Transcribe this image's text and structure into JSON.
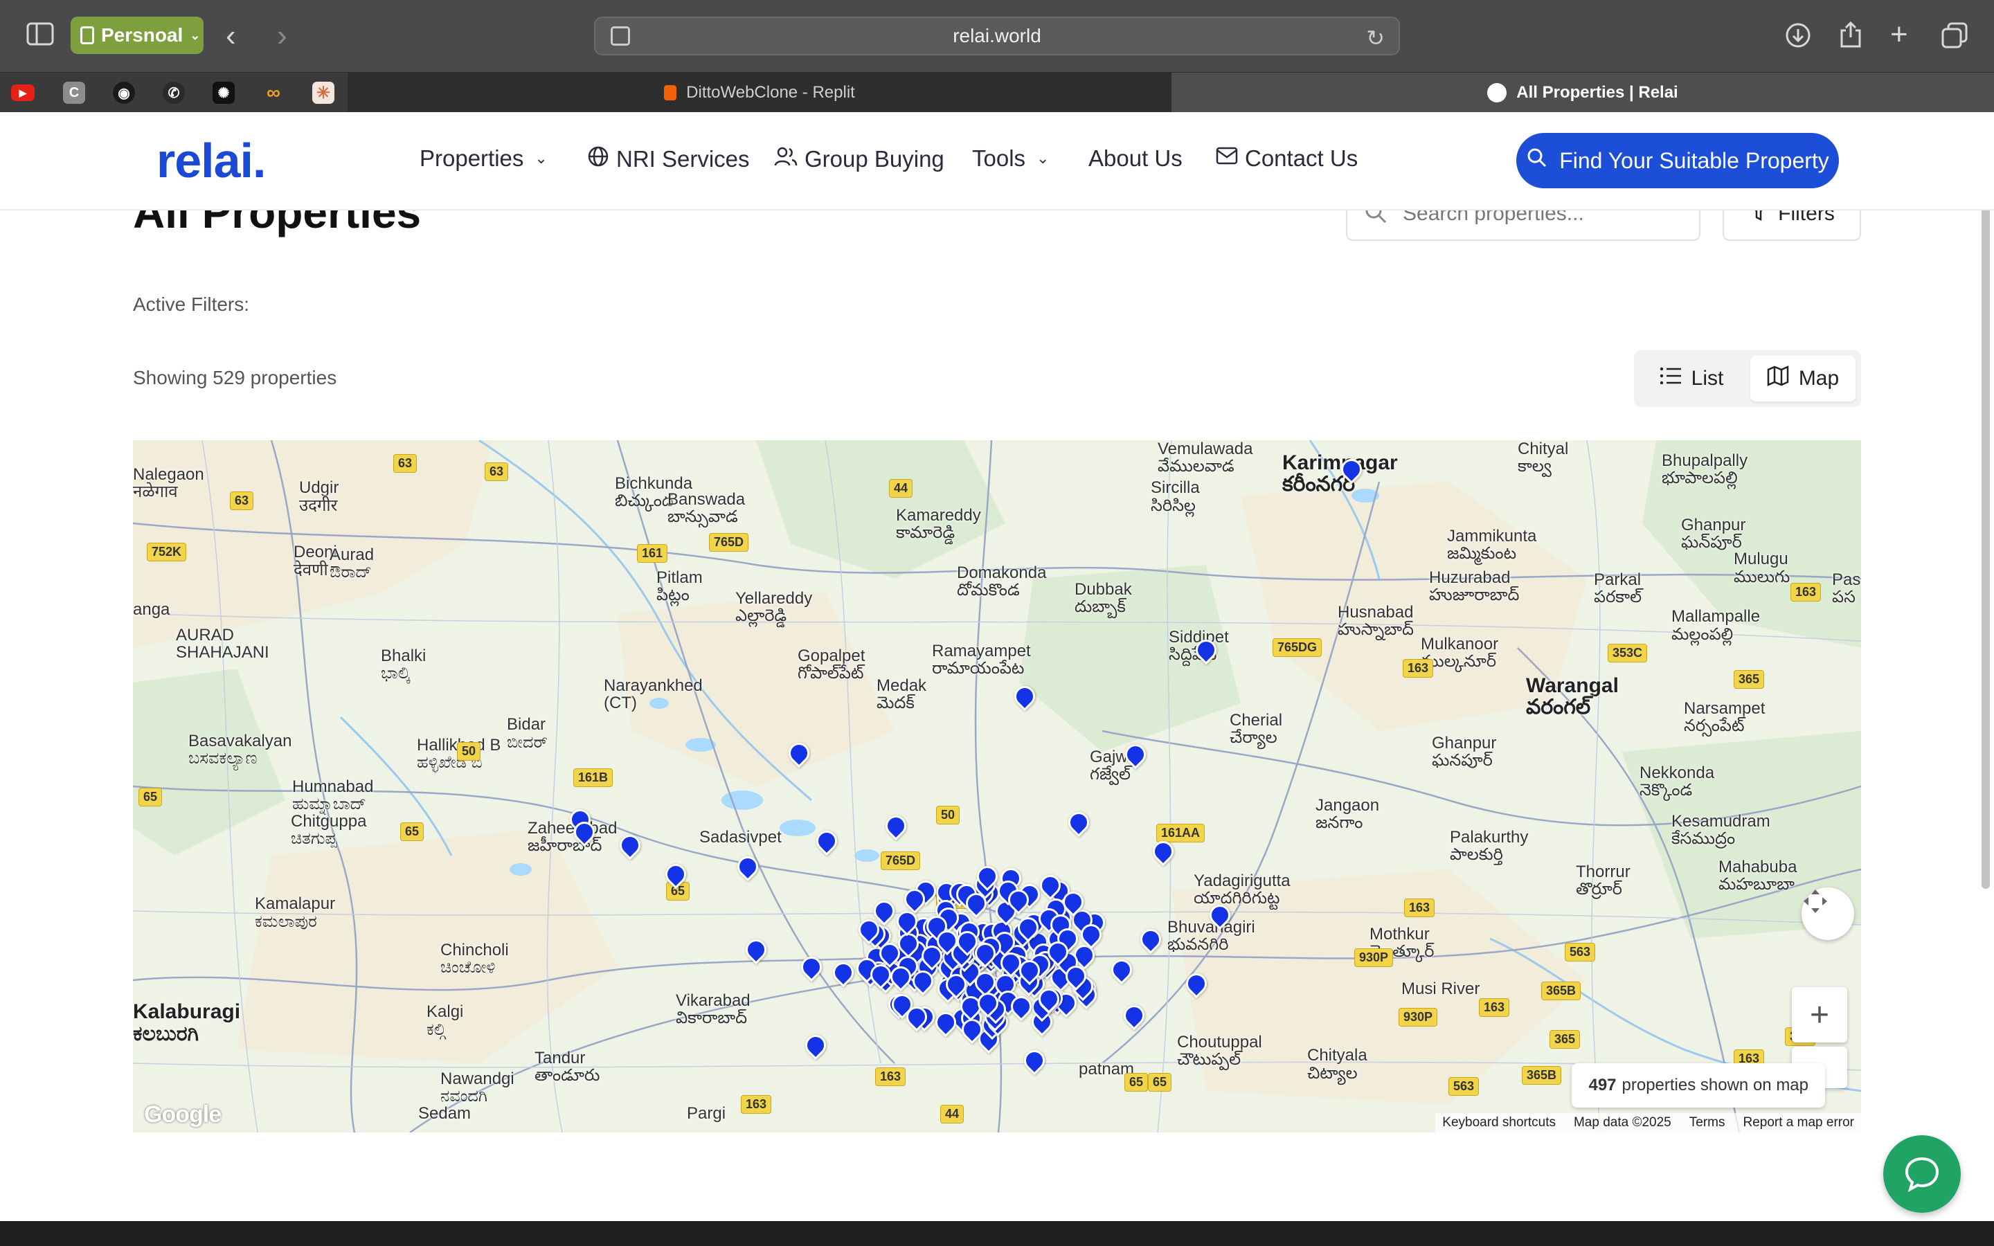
{
  "browser": {
    "profile_label": "Persnoal",
    "url": "relai.world",
    "tabs": [
      {
        "title": "DittoWebClone - Replit"
      },
      {
        "title": "All Properties | Relai"
      }
    ],
    "pinned": [
      "youtube",
      "c",
      "github",
      "whatsapp",
      "chatgpt",
      "infinity",
      "claude"
    ]
  },
  "site": {
    "logo": "relai.",
    "nav": {
      "properties": "Properties",
      "nri": "NRI Services",
      "group": "Group Buying",
      "tools": "Tools",
      "about": "About Us",
      "contact": "Contact Us"
    },
    "cta": "Find Your Suitable Property"
  },
  "page": {
    "title": "All Properties",
    "search_placeholder": "Search properties...",
    "filters_label": "Filters",
    "active_filters_label": "Active Filters:",
    "showing_text": "Showing 529 properties",
    "view_list": "List",
    "view_map": "Map"
  },
  "map": {
    "count_number": "497",
    "count_text": "properties shown on map",
    "footer": {
      "shortcuts": "Keyboard shortcuts",
      "data": "Map data ©2025",
      "terms": "Terms",
      "report": "Report a map error"
    },
    "google_label": "Google",
    "labels": [
      {
        "id": "nalegaon",
        "t1": "Nalegaon",
        "t2": "नळेगाव"
      },
      {
        "id": "udgir",
        "t1": "Udgir",
        "t2": "उदगीर"
      },
      {
        "id": "deoni",
        "t1": "Deoni",
        "t2": "देवणी"
      },
      {
        "id": "aurad",
        "t1": "Aurad",
        "t2": "ಔರಾದ್"
      },
      {
        "id": "aurad_shahajani",
        "t1": "AURAD",
        "t2": "SHAHAJANI"
      },
      {
        "id": "bhalki",
        "t1": "Bhalki",
        "t2": "ಭಾಲ್ಕಿ"
      },
      {
        "id": "basavakalyan",
        "t1": "Basavakalyan",
        "t2": "ಬಸವಕಲ್ಯಾಣ"
      },
      {
        "id": "humnabad",
        "t1": "Humnabad",
        "t2": "ಹುಮ್ನಾಬಾದ್"
      },
      {
        "id": "hallikhed",
        "t1": "Hallikhed B",
        "t2": "ಹಳ್ಳಿಖೇಡ ಬಿ"
      },
      {
        "id": "bidar",
        "t1": "Bidar",
        "t2": "ಬೀದರ್"
      },
      {
        "id": "chitguppa",
        "t1": "Chitguppa",
        "t2": "ಚಿತಗುಪ್ಪ"
      },
      {
        "id": "kamalapur",
        "t1": "Kamalapur",
        "t2": "ಕಮಲಾಪುರ"
      },
      {
        "id": "chincholi",
        "t1": "Chincholi",
        "t2": "ಚಿಂಚೋಳಿ"
      },
      {
        "id": "kalgi",
        "t1": "Kalgi",
        "t2": "ಕಲ್ಗಿ"
      },
      {
        "id": "kalaburagi",
        "t1": "Kalaburagi",
        "t2": "ಕಲಬುರಗಿ"
      },
      {
        "id": "tandur",
        "t1": "Tandur",
        "t2": "తాండూరు"
      },
      {
        "id": "nawandgi",
        "t1": "Nawandgi",
        "t2": "ನವಂದಗಿ"
      },
      {
        "id": "sedam",
        "t1": "Sedam",
        "t2": ""
      },
      {
        "id": "bichkunda",
        "t1": "Bichkunda",
        "t2": "బిచ్కుంద"
      },
      {
        "id": "banswada",
        "t1": "Banswada",
        "t2": "బాన్సువాడ"
      },
      {
        "id": "pitlam",
        "t1": "Pitlam",
        "t2": "పిట్లం"
      },
      {
        "id": "yellareddy",
        "t1": "Yellareddy",
        "t2": "ఎల్లారెడ్డి"
      },
      {
        "id": "kamareddy",
        "t1": "Kamareddy",
        "t2": "కామారెడ్డి"
      },
      {
        "id": "domakonda",
        "t1": "Domakonda",
        "t2": "దోమకొండ"
      },
      {
        "id": "gopalpet",
        "t1": "Gopalpet",
        "t2": "గోపాల్‌పేట్"
      },
      {
        "id": "ramayampet",
        "t1": "Ramayampet",
        "t2": "రామాయంపేట"
      },
      {
        "id": "medak",
        "t1": "Medak",
        "t2": "మెదక్"
      },
      {
        "id": "narayankhed",
        "t1": "Narayankhed",
        "t2": "(CT)"
      },
      {
        "id": "zaheerabad",
        "t1": "Zaheerabad",
        "t2": "జహీరాబాద్"
      },
      {
        "id": "sadasivpet",
        "t1": "Sadasivpet",
        "t2": ""
      },
      {
        "id": "vikarabad",
        "t1": "Vikarabad",
        "t2": "వికారాబాద్"
      },
      {
        "id": "vemulawada",
        "t1": "Vemulawada",
        "t2": "వేములవాడ"
      },
      {
        "id": "sircilla",
        "t1": "Sircilla",
        "t2": "సిరిసిల్ల"
      },
      {
        "id": "dubbak",
        "t1": "Dubbak",
        "t2": "దుబ్బాక్"
      },
      {
        "id": "siddipet",
        "t1": "Siddipet",
        "t2": "సిద్దిపేట"
      },
      {
        "id": "gajwel",
        "t1": "Gajwel",
        "t2": "గజ్వేల్"
      },
      {
        "id": "cherial",
        "t1": "Cherial",
        "t2": "చేర్యాల"
      },
      {
        "id": "jangaon",
        "t1": "Jangaon",
        "t2": "జనగాం"
      },
      {
        "id": "yadagirigutta",
        "t1": "Yadagirigutta",
        "t2": "యాదగిరిగుట్ట"
      },
      {
        "id": "bhuvanagiri",
        "t1": "Bhuvanagiri",
        "t2": "భువనగిరి"
      },
      {
        "id": "choutuppal",
        "t1": "Choutuppal",
        "t2": "చౌటుప్పల్"
      },
      {
        "id": "chityala",
        "t1": "Chityala",
        "t2": "చిట్యాల"
      },
      {
        "id": "karimnagar",
        "t1": "Karimnagar",
        "t2": "కరీంనగర్"
      },
      {
        "id": "jammikunta",
        "t1": "Jammikunta",
        "t2": "జమ్మికుంట"
      },
      {
        "id": "huzurabad",
        "t1": "Huzurabad",
        "t2": "హుజూరాబాద్"
      },
      {
        "id": "husnabad",
        "t1": "Husnabad",
        "t2": "హుస్నాబాద్"
      },
      {
        "id": "mulkanoor",
        "t1": "Mulkanoor",
        "t2": "ముల్కనూర్"
      },
      {
        "id": "warangal",
        "t1": "Warangal",
        "t2": "వరంగల్"
      },
      {
        "id": "ghanpur",
        "t1": "Ghanpur",
        "t2": "ఘనపూర్"
      },
      {
        "id": "palakurthy",
        "t1": "Palakurthy",
        "t2": "పాలకుర్తి"
      },
      {
        "id": "thorrur",
        "t1": "Thorrur",
        "t2": "తొర్రూర్"
      },
      {
        "id": "mothkur",
        "t1": "Mothkur",
        "t2": "మోత్కూర్"
      },
      {
        "id": "musi",
        "t1": "Musi River",
        "t2": ""
      },
      {
        "id": "bhupalpally",
        "t1": "Bhupalpally",
        "t2": "భూపాలపల్లి"
      },
      {
        "id": "ghanpur2",
        "t1": "Ghanpur",
        "t2": "ఘన్‌పూర్"
      },
      {
        "id": "parkal",
        "t1": "Parkal",
        "t2": "పరకాల్"
      },
      {
        "id": "mulugu",
        "t1": "Mulugu",
        "t2": "ములుగు"
      },
      {
        "id": "mallampalle",
        "t1": "Mallampalle",
        "t2": "మల్లంపల్లి"
      },
      {
        "id": "narsampet",
        "t1": "Narsampet",
        "t2": "నర్సంపేట్"
      },
      {
        "id": "nekkonda",
        "t1": "Nekkonda",
        "t2": "నెక్కొండ"
      },
      {
        "id": "kesamudram",
        "t1": "Kesamudram",
        "t2": "కేసముద్రం"
      },
      {
        "id": "mahabubabad",
        "t1": "Mahabuba",
        "t2": "మహబూబా"
      },
      {
        "id": "chityal_top",
        "t1": "Chityal",
        "t2": "కాల్వ"
      },
      {
        "id": "pitla",
        "t1": "Pas",
        "t2": "పస"
      },
      {
        "id": "anga",
        "t1": "anga",
        "t2": ""
      },
      {
        "id": "ibrahimpatnam",
        "t1": "patnam",
        "t2": ""
      },
      {
        "id": "pargi",
        "t1": "Pargi",
        "t2": ""
      }
    ],
    "shields": [
      "63",
      "63",
      "63",
      "752K",
      "161",
      "765D",
      "44",
      "50",
      "161B",
      "65",
      "65",
      "65",
      "50",
      "161AA",
      "765D",
      "161AA",
      "765DG",
      "163",
      "353C",
      "365",
      "163",
      "163",
      "365B",
      "930P",
      "930P",
      "365",
      "365B",
      "365",
      "163",
      "365",
      "163",
      "65",
      "44",
      "163",
      "163",
      "65",
      "563",
      "563",
      "563"
    ]
  }
}
